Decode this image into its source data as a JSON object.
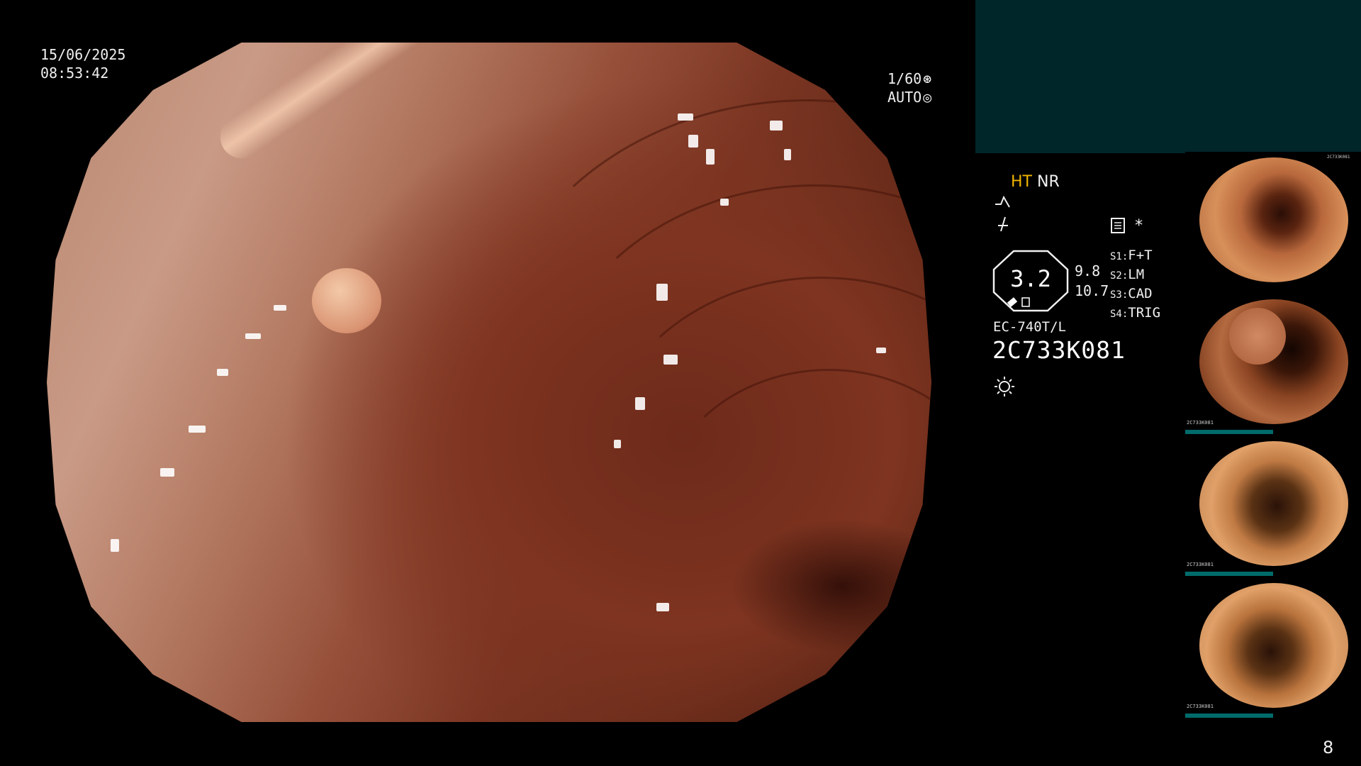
{
  "osd": {
    "date": "15/06/2025",
    "time": "08:53:42",
    "shutter": "1/60",
    "iris": "AUTO",
    "mode_ht": "HT",
    "mode_nr": "NR",
    "gauge_value": "3.2",
    "gauge_upper": "9.8",
    "gauge_lower": "10.7",
    "scope_model": "EC-740T/L",
    "serial": "2C733K081",
    "switches": [
      {
        "key": "S1:",
        "value": "F+T"
      },
      {
        "key": "S2:",
        "value": "LM"
      },
      {
        "key": "S3:",
        "value": "CAD"
      },
      {
        "key": "S4:",
        "value": "TRIG"
      }
    ],
    "asterisk": "*",
    "page_number": "8"
  },
  "colors": {
    "ht_label": "#f0b400",
    "panel_box": "#00262a",
    "thumb_bar": "#006b6b"
  },
  "icons": [
    "shutter-icon",
    "iris-icon",
    "enhance-curve-icon",
    "filter-icon",
    "memory-card-icon",
    "light-source-icon"
  ],
  "thumbnails": [
    {
      "index": 1,
      "label": "2C733K081"
    },
    {
      "index": 2,
      "label": "2C733K081"
    },
    {
      "index": 3,
      "label": "2C733K081"
    },
    {
      "index": 4,
      "label": "2C733K081"
    }
  ]
}
